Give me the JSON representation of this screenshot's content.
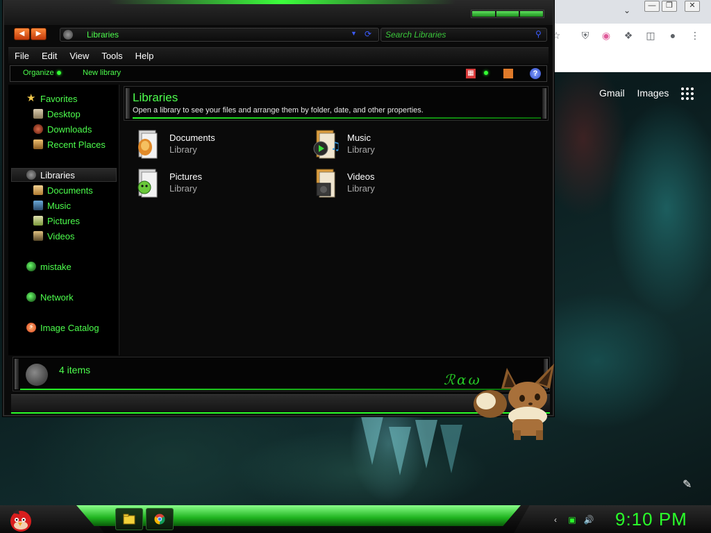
{
  "explorer": {
    "address": {
      "location": "Libraries"
    },
    "search": {
      "placeholder": "Search Libraries"
    },
    "menu": [
      "File",
      "Edit",
      "View",
      "Tools",
      "Help"
    ],
    "command_bar": {
      "organize_label": "Organize",
      "new_library_label": "New library"
    },
    "nav": {
      "favorites": {
        "header": "Favorites",
        "items": [
          "Desktop",
          "Downloads",
          "Recent Places"
        ]
      },
      "libraries": {
        "header": "Libraries",
        "items": [
          "Documents",
          "Music",
          "Pictures",
          "Videos"
        ]
      },
      "homegroup_label": "mistake",
      "network_label": "Network",
      "image_catalog_label": "Image Catalog"
    },
    "content": {
      "title": "Libraries",
      "description": "Open a library to see your files and arrange them by folder, date, and other properties.",
      "libraries": [
        {
          "name": "Documents",
          "type": "Library",
          "icon": "documents-library-icon"
        },
        {
          "name": "Music",
          "type": "Library",
          "icon": "music-library-icon"
        },
        {
          "name": "Pictures",
          "type": "Library",
          "icon": "pictures-library-icon"
        },
        {
          "name": "Videos",
          "type": "Library",
          "icon": "videos-library-icon"
        }
      ]
    },
    "details": {
      "item_count": "4 items"
    }
  },
  "browser": {
    "links": [
      "Gmail",
      "Images"
    ]
  },
  "taskbar": {
    "clock": "9:10 PM",
    "pinned": [
      "file-explorer-icon",
      "chrome-icon"
    ]
  },
  "theme": {
    "accent_green": "#4dff4d",
    "window_bg": "#0a0a0a",
    "clock_green": "#2aff2a"
  }
}
